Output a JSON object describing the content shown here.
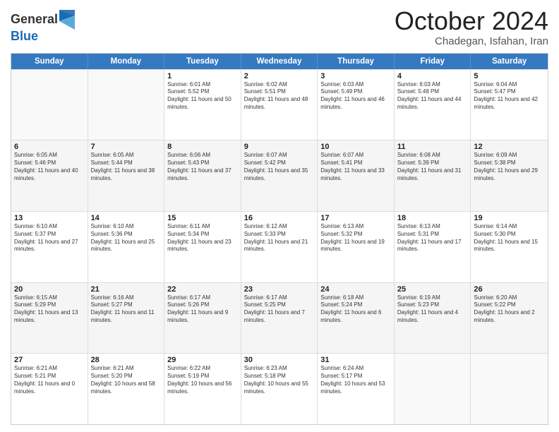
{
  "logo": {
    "line1": "General",
    "line2": "Blue"
  },
  "header": {
    "month": "October 2024",
    "location": "Chadegan, Isfahan, Iran"
  },
  "weekdays": [
    "Sunday",
    "Monday",
    "Tuesday",
    "Wednesday",
    "Thursday",
    "Friday",
    "Saturday"
  ],
  "rows": [
    {
      "cells": [
        {
          "day": "",
          "sunrise": "",
          "sunset": "",
          "daylight": ""
        },
        {
          "day": "",
          "sunrise": "",
          "sunset": "",
          "daylight": ""
        },
        {
          "day": "1",
          "sunrise": "Sunrise: 6:01 AM",
          "sunset": "Sunset: 5:52 PM",
          "daylight": "Daylight: 11 hours and 50 minutes."
        },
        {
          "day": "2",
          "sunrise": "Sunrise: 6:02 AM",
          "sunset": "Sunset: 5:51 PM",
          "daylight": "Daylight: 11 hours and 48 minutes."
        },
        {
          "day": "3",
          "sunrise": "Sunrise: 6:03 AM",
          "sunset": "Sunset: 5:49 PM",
          "daylight": "Daylight: 11 hours and 46 minutes."
        },
        {
          "day": "4",
          "sunrise": "Sunrise: 6:03 AM",
          "sunset": "Sunset: 5:48 PM",
          "daylight": "Daylight: 11 hours and 44 minutes."
        },
        {
          "day": "5",
          "sunrise": "Sunrise: 6:04 AM",
          "sunset": "Sunset: 5:47 PM",
          "daylight": "Daylight: 11 hours and 42 minutes."
        }
      ]
    },
    {
      "cells": [
        {
          "day": "6",
          "sunrise": "Sunrise: 6:05 AM",
          "sunset": "Sunset: 5:46 PM",
          "daylight": "Daylight: 11 hours and 40 minutes."
        },
        {
          "day": "7",
          "sunrise": "Sunrise: 6:05 AM",
          "sunset": "Sunset: 5:44 PM",
          "daylight": "Daylight: 11 hours and 38 minutes."
        },
        {
          "day": "8",
          "sunrise": "Sunrise: 6:06 AM",
          "sunset": "Sunset: 5:43 PM",
          "daylight": "Daylight: 11 hours and 37 minutes."
        },
        {
          "day": "9",
          "sunrise": "Sunrise: 6:07 AM",
          "sunset": "Sunset: 5:42 PM",
          "daylight": "Daylight: 11 hours and 35 minutes."
        },
        {
          "day": "10",
          "sunrise": "Sunrise: 6:07 AM",
          "sunset": "Sunset: 5:41 PM",
          "daylight": "Daylight: 11 hours and 33 minutes."
        },
        {
          "day": "11",
          "sunrise": "Sunrise: 6:08 AM",
          "sunset": "Sunset: 5:39 PM",
          "daylight": "Daylight: 11 hours and 31 minutes."
        },
        {
          "day": "12",
          "sunrise": "Sunrise: 6:09 AM",
          "sunset": "Sunset: 5:38 PM",
          "daylight": "Daylight: 11 hours and 29 minutes."
        }
      ]
    },
    {
      "cells": [
        {
          "day": "13",
          "sunrise": "Sunrise: 6:10 AM",
          "sunset": "Sunset: 5:37 PM",
          "daylight": "Daylight: 11 hours and 27 minutes."
        },
        {
          "day": "14",
          "sunrise": "Sunrise: 6:10 AM",
          "sunset": "Sunset: 5:36 PM",
          "daylight": "Daylight: 11 hours and 25 minutes."
        },
        {
          "day": "15",
          "sunrise": "Sunrise: 6:11 AM",
          "sunset": "Sunset: 5:34 PM",
          "daylight": "Daylight: 11 hours and 23 minutes."
        },
        {
          "day": "16",
          "sunrise": "Sunrise: 6:12 AM",
          "sunset": "Sunset: 5:33 PM",
          "daylight": "Daylight: 11 hours and 21 minutes."
        },
        {
          "day": "17",
          "sunrise": "Sunrise: 6:13 AM",
          "sunset": "Sunset: 5:32 PM",
          "daylight": "Daylight: 11 hours and 19 minutes."
        },
        {
          "day": "18",
          "sunrise": "Sunrise: 6:13 AM",
          "sunset": "Sunset: 5:31 PM",
          "daylight": "Daylight: 11 hours and 17 minutes."
        },
        {
          "day": "19",
          "sunrise": "Sunrise: 6:14 AM",
          "sunset": "Sunset: 5:30 PM",
          "daylight": "Daylight: 11 hours and 15 minutes."
        }
      ]
    },
    {
      "cells": [
        {
          "day": "20",
          "sunrise": "Sunrise: 6:15 AM",
          "sunset": "Sunset: 5:29 PM",
          "daylight": "Daylight: 11 hours and 13 minutes."
        },
        {
          "day": "21",
          "sunrise": "Sunrise: 6:16 AM",
          "sunset": "Sunset: 5:27 PM",
          "daylight": "Daylight: 11 hours and 11 minutes."
        },
        {
          "day": "22",
          "sunrise": "Sunrise: 6:17 AM",
          "sunset": "Sunset: 5:26 PM",
          "daylight": "Daylight: 11 hours and 9 minutes."
        },
        {
          "day": "23",
          "sunrise": "Sunrise: 6:17 AM",
          "sunset": "Sunset: 5:25 PM",
          "daylight": "Daylight: 11 hours and 7 minutes."
        },
        {
          "day": "24",
          "sunrise": "Sunrise: 6:18 AM",
          "sunset": "Sunset: 5:24 PM",
          "daylight": "Daylight: 11 hours and 6 minutes."
        },
        {
          "day": "25",
          "sunrise": "Sunrise: 6:19 AM",
          "sunset": "Sunset: 5:23 PM",
          "daylight": "Daylight: 11 hours and 4 minutes."
        },
        {
          "day": "26",
          "sunrise": "Sunrise: 6:20 AM",
          "sunset": "Sunset: 5:22 PM",
          "daylight": "Daylight: 11 hours and 2 minutes."
        }
      ]
    },
    {
      "cells": [
        {
          "day": "27",
          "sunrise": "Sunrise: 6:21 AM",
          "sunset": "Sunset: 5:21 PM",
          "daylight": "Daylight: 11 hours and 0 minutes."
        },
        {
          "day": "28",
          "sunrise": "Sunrise: 6:21 AM",
          "sunset": "Sunset: 5:20 PM",
          "daylight": "Daylight: 10 hours and 58 minutes."
        },
        {
          "day": "29",
          "sunrise": "Sunrise: 6:22 AM",
          "sunset": "Sunset: 5:19 PM",
          "daylight": "Daylight: 10 hours and 56 minutes."
        },
        {
          "day": "30",
          "sunrise": "Sunrise: 6:23 AM",
          "sunset": "Sunset: 5:18 PM",
          "daylight": "Daylight: 10 hours and 55 minutes."
        },
        {
          "day": "31",
          "sunrise": "Sunrise: 6:24 AM",
          "sunset": "Sunset: 5:17 PM",
          "daylight": "Daylight: 10 hours and 53 minutes."
        },
        {
          "day": "",
          "sunrise": "",
          "sunset": "",
          "daylight": ""
        },
        {
          "day": "",
          "sunrise": "",
          "sunset": "",
          "daylight": ""
        }
      ]
    }
  ]
}
